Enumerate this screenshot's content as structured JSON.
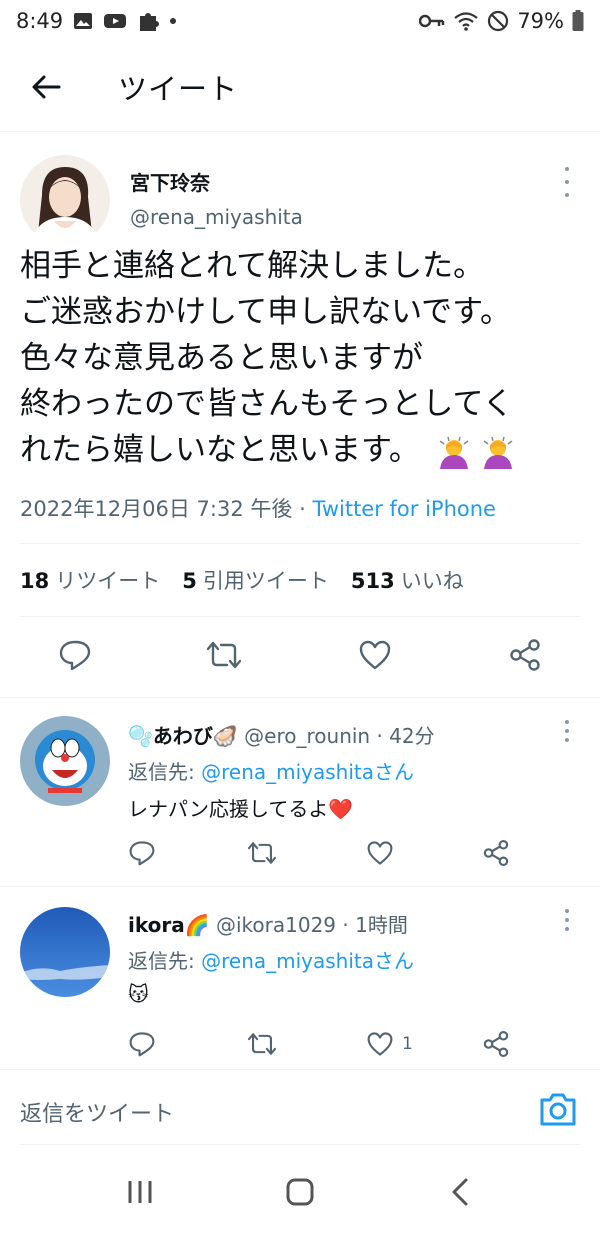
{
  "status_bar": {
    "time": "8:49",
    "battery": "79%"
  },
  "header": {
    "title": "ツイート"
  },
  "tweet": {
    "author_name": "宮下玲奈",
    "author_handle": "@rena_miyashita",
    "text_lines": [
      "相手と連絡とれて解決しました。",
      "ご迷惑おかけして申し訳ないです。",
      "色々な意見あると思いますが",
      "終わったので皆さんもそっとしてく",
      "れたら嬉しいなと思います。"
    ],
    "emoji": "🙇‍♀️🙇‍♀️",
    "timestamp": "2022年12月06日 7:32 午後",
    "separator": "·",
    "source": "Twitter for iPhone",
    "stats": {
      "retweets_count": "18",
      "retweets_label": "リツイート",
      "quotes_count": "5",
      "quotes_label": "引用ツイート",
      "likes_count": "513",
      "likes_label": "いいね"
    }
  },
  "replies": [
    {
      "name": "あわび",
      "name_prefix_emoji": "🫧",
      "name_suffix_emoji": "🦪",
      "handle": "@ero_rounin",
      "time": "· 42分",
      "reply_to_label": "返信先: ",
      "reply_to_mention": "@rena_miyashitaさん",
      "text": "レナパン応援してるよ❤️",
      "like_count": ""
    },
    {
      "name": "ikora",
      "name_prefix_emoji": "",
      "name_suffix_emoji": "🌈",
      "handle": "@ikora1029",
      "time": "· 1時間",
      "reply_to_label": "返信先: ",
      "reply_to_mention": "@rena_miyashitaさん",
      "text": "😽",
      "like_count": "1"
    }
  ],
  "compose": {
    "placeholder": "返信をツイート"
  },
  "colors": {
    "accent": "#1d9bf0",
    "text": "#0f1419",
    "secondary": "#536471",
    "divider": "#eff3f4"
  }
}
